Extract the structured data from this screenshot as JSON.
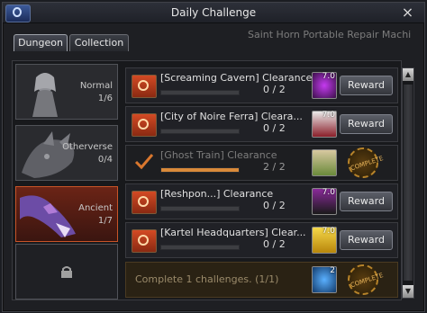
{
  "window": {
    "title": "Daily Challenge"
  },
  "tabs": [
    {
      "label": "Dungeon",
      "active": true
    },
    {
      "label": "Collection",
      "active": false
    }
  ],
  "ticker": "Saint Horn Portable Repair Machi",
  "difficulties": [
    {
      "label": "Normal",
      "count": "1/6",
      "state": "normal"
    },
    {
      "label": "Otherverse",
      "count": "0/4",
      "state": "normal"
    },
    {
      "label": "Ancient",
      "count": "1/7",
      "state": "selected"
    },
    {
      "label": "",
      "count": "",
      "state": "locked"
    }
  ],
  "quests": [
    {
      "title": "[Screaming Cavern] Clearance",
      "progress": "0 / 2",
      "fraction": 0,
      "item_level": "7.0",
      "button": "Reward",
      "done": false
    },
    {
      "title": "[City of Noire Ferra] Cleara...",
      "progress": "0 / 2",
      "fraction": 0,
      "item_level": "7.0",
      "button": "Reward",
      "done": false
    },
    {
      "title": "[Ghost Train] Clearance",
      "progress": "2 / 2",
      "fraction": 1,
      "item_level": "",
      "button": "COMPLETE",
      "done": true
    },
    {
      "title": "[Reshpon...] Clearance",
      "progress": "0 / 2",
      "fraction": 0,
      "item_level": "7.0",
      "button": "Reward",
      "done": false
    },
    {
      "title": "[Kartel Headquarters] Clear...",
      "progress": "0 / 2",
      "fraction": 0,
      "item_level": "7.0",
      "button": "Reward",
      "done": false
    }
  ],
  "summary": {
    "text": "Complete 1 challenges. (1/1)",
    "item_count": "2",
    "stamp": "COMPLETE"
  },
  "colors": {
    "accent": "#d98a3a",
    "selected": "#c85428",
    "stamp": "#b8842a"
  },
  "icons": {
    "close": "×",
    "scroll_up": "▲",
    "scroll_down": "▼"
  }
}
